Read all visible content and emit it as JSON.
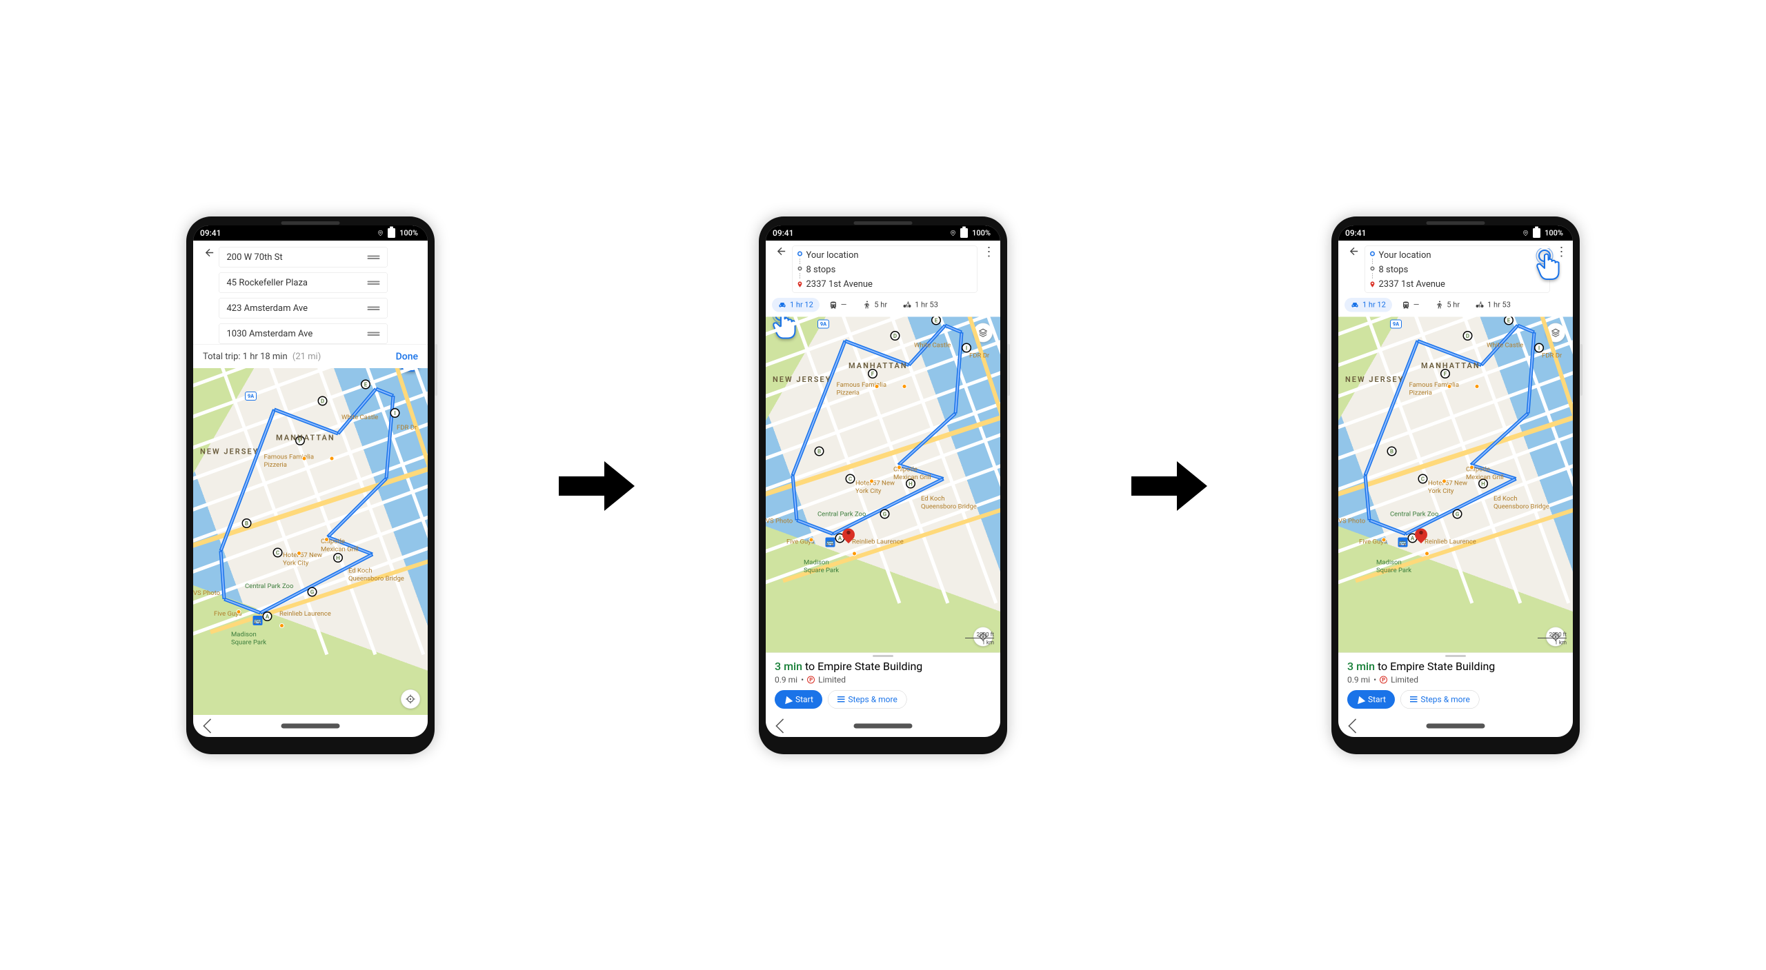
{
  "status": {
    "time": "09:41",
    "battery": "100%"
  },
  "screen1": {
    "stops": [
      "200 W 70th St",
      "45 Rockefeller Plaza",
      "423 Amsterdam Ave",
      "1030 Amsterdam Ave"
    ],
    "trip_label": "Total trip: 1 hr 18 min",
    "trip_distance": "(21 mi)",
    "done": "Done"
  },
  "route_header": {
    "origin": "Your location",
    "mid": "8 stops",
    "dest": "2337 1st Avenue"
  },
  "modes": {
    "drive": "1 hr 12",
    "transit": "—",
    "walk": "5 hr",
    "bike": "1 hr 53"
  },
  "sheet": {
    "eta": "3 min",
    "rest": " to Empire State Building",
    "distance": "0.9 mi",
    "dot": "•",
    "parking": "Limited",
    "start": "Start",
    "steps": "Steps & more"
  },
  "map": {
    "stops": [
      "A",
      "B",
      "C",
      "D",
      "E",
      "F",
      "G",
      "H",
      "I"
    ],
    "area_manhattan": "MANHATTAN",
    "area_nj": "NEW JERSEY",
    "park_zoo": "Central Park Zoo",
    "park_sq": "Madison\nSquare Park",
    "poi_pizza": "Famous Famiglia\nPizzeria",
    "poi_whitecastle": "White Castle",
    "poi_fdr": "FDR Dr",
    "poi_chipotle": "Chipotle\nMexican Grill",
    "poi_hotel57": "Hotel 57 New\nYork City",
    "poi_cvs": "VS Photo",
    "poi_fiveguys": "Five Guys",
    "poi_reinlieb": "Reinlieb Laurence",
    "poi_edkoch": "Ed Koch\nQueensboro Bridge",
    "hwy_9a": "9A",
    "scale_ft": "2000 ft",
    "scale_km": "1 km"
  }
}
